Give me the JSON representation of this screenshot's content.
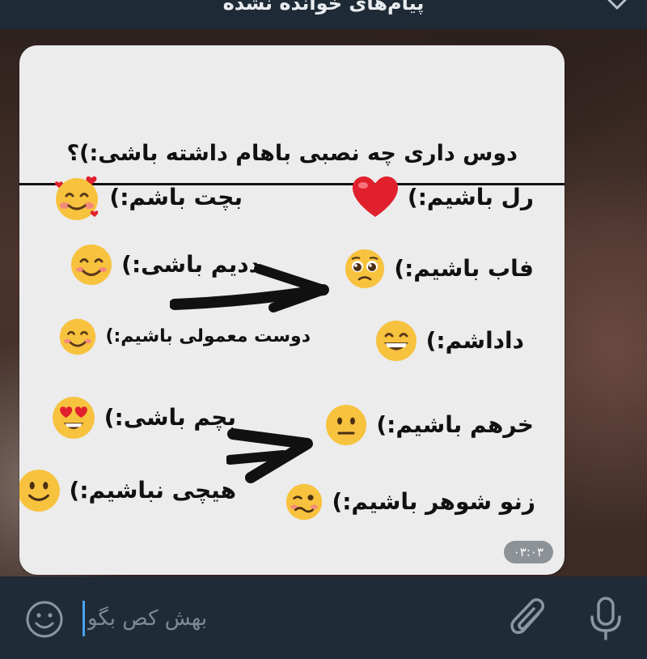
{
  "header": {
    "unread_label": "پیام‌های خوانده نشده"
  },
  "message": {
    "title": "دوس داری چه نصبی باهام داشته باشی:)؟",
    "options": [
      {
        "label": "رل باشیم:)",
        "icon": "red-heart-emoji"
      },
      {
        "label": "بچت باشم:)",
        "icon": "smiling-face-with-hearts-emoji"
      },
      {
        "label": "فاب باشیم:)",
        "icon": "pleading-face-emoji"
      },
      {
        "label": "ددیم باشی:)",
        "icon": "smiling-face-emoji"
      },
      {
        "label": "داداشم:)",
        "icon": "grinning-face-emoji"
      },
      {
        "label": "دوست معمولی باشیم:)",
        "icon": "smiling-face-emoji"
      },
      {
        "label": "خرهم باشیم:)",
        "icon": "neutral-face-emoji"
      },
      {
        "label": "بچم باشی:)",
        "icon": "heart-eyes-emoji"
      },
      {
        "label": "زنو شوهر باشیم:)",
        "icon": "woozy-face-emoji"
      },
      {
        "label": "هیچی نباشیم:)",
        "icon": "slightly-smiling-face-emoji"
      }
    ],
    "time": "۰۳:۰۳"
  },
  "composer": {
    "placeholder": "بهش کص بگو"
  },
  "colors": {
    "bubble": "#ececed",
    "bar": "#1f2b36",
    "caret": "#4aa3f2",
    "emoji_yellow": "#f7c23e",
    "heart_red": "#e0202c"
  }
}
